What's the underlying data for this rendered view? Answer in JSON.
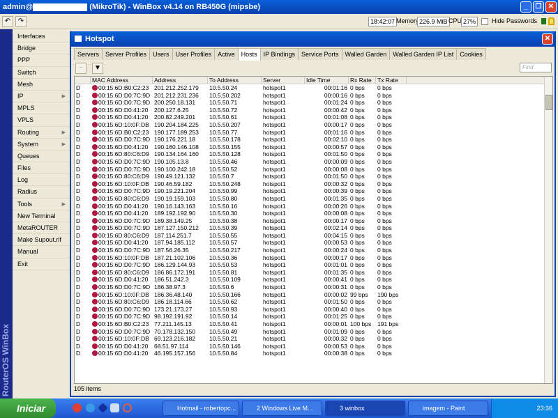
{
  "window": {
    "title_prefix": "admin@",
    "title_suffix": "(MikroTik) - WinBox v4.14 on RB450G (mipsbe)"
  },
  "toolbar": {
    "undo": "↶",
    "redo": "↷",
    "time": "18:42:07",
    "memory_label": "Memory:",
    "memory": "226.9 MiB",
    "cpu_label": "CPU:",
    "cpu": "27%",
    "hide_passwords": "Hide Passwords"
  },
  "sidebar": {
    "brand": "RouterOS WinBox",
    "items": [
      {
        "label": "Interfaces"
      },
      {
        "label": "Bridge"
      },
      {
        "label": "PPP"
      },
      {
        "label": "Switch"
      },
      {
        "label": "Mesh"
      },
      {
        "label": "IP",
        "sub": "▶"
      },
      {
        "label": "MPLS"
      },
      {
        "label": "VPLS"
      },
      {
        "label": "Routing",
        "sub": "▶"
      },
      {
        "label": "System",
        "sub": "▶"
      },
      {
        "label": "Queues"
      },
      {
        "label": "Files"
      },
      {
        "label": "Log"
      },
      {
        "label": "Radius"
      },
      {
        "label": "Tools",
        "sub": "▶"
      },
      {
        "label": "New Terminal"
      },
      {
        "label": "MetaROUTER"
      },
      {
        "label": "Make Supout.rif"
      },
      {
        "label": "Manual"
      },
      {
        "label": "Exit"
      }
    ]
  },
  "hotspot": {
    "title": "Hotspot",
    "tabs": [
      "Servers",
      "Server Profiles",
      "Users",
      "User Profiles",
      "Active",
      "Hosts",
      "IP Bindings",
      "Service Ports",
      "Walled Garden",
      "Walled Garden IP List",
      "Cookies"
    ],
    "active_tab": "Hosts",
    "find_placeholder": "Find",
    "columns": [
      "",
      "MAC Address",
      "Address",
      "To Address",
      "Server",
      "Idle Time",
      "Rx Rate",
      "Tx Rate"
    ],
    "rows": [
      [
        "D",
        "00:15:6D:B0:C2:23",
        "201.212.252.179",
        "10.5.50.24",
        "hotspot1",
        "00:01:16",
        "0 bps",
        "0 bps"
      ],
      [
        "D",
        "00:15:6D:D0:7C:9D",
        "201.212.231.236",
        "10.5.50.202",
        "hotspot1",
        "00:00:16",
        "0 bps",
        "0 bps"
      ],
      [
        "D",
        "00:15:6D:D0:7C:9D",
        "200.250.18.131",
        "10.5.50.71",
        "hotspot1",
        "00:01:24",
        "0 bps",
        "0 bps"
      ],
      [
        "D",
        "00:15:6D:D0:41:20",
        "200.127.6.25",
        "10.5.50.72",
        "hotspot1",
        "00:00:42",
        "0 bps",
        "0 bps"
      ],
      [
        "D",
        "00:15:6D:D0:41:20",
        "200.82.249.201",
        "10.5.50.61",
        "hotspot1",
        "00:01:08",
        "0 bps",
        "0 bps"
      ],
      [
        "D",
        "00:15:6D:10:0F:DB",
        "190.204.184.225",
        "10.5.50.207",
        "hotspot1",
        "00:00:17",
        "0 bps",
        "0 bps"
      ],
      [
        "D",
        "00:15:6D:B0:C2:23",
        "190.177.189.253",
        "10.5.50.77",
        "hotspot1",
        "00:01:16",
        "0 bps",
        "0 bps"
      ],
      [
        "D",
        "00:15:6D:D0:7C:9D",
        "190.176.221.18",
        "10.5.50.178",
        "hotspot1",
        "00:02:10",
        "0 bps",
        "0 bps"
      ],
      [
        "D",
        "00:15:6D:D0:41:20",
        "190.160.146.108",
        "10.5.50.155",
        "hotspot1",
        "00:00:57",
        "0 bps",
        "0 bps"
      ],
      [
        "D",
        "00:15:6D:80:C6:D9",
        "190.134.164.160",
        "10.5.50.128",
        "hotspot1",
        "00:01:50",
        "0 bps",
        "0 bps"
      ],
      [
        "D",
        "00:15:6D:D0:7C:9D",
        "190.105.13.8",
        "10.5.50.46",
        "hotspot1",
        "00:00:09",
        "0 bps",
        "0 bps"
      ],
      [
        "D",
        "00:15:6D:D0:7C:9D",
        "190.100.242.18",
        "10.5.50.52",
        "hotspot1",
        "00:00:08",
        "0 bps",
        "0 bps"
      ],
      [
        "D",
        "00:15:6D:80:C6:D9",
        "190.49.121.132",
        "10.5.50.7",
        "hotspot1",
        "00:01:50",
        "0 bps",
        "0 bps"
      ],
      [
        "D",
        "00:15:6D:10:0F:DB",
        "190.46.59.182",
        "10.5.50.248",
        "hotspot1",
        "00:00:32",
        "0 bps",
        "0 bps"
      ],
      [
        "D",
        "00:15:6D:D0:7C:9D",
        "190.19.221.204",
        "10.5.50.99",
        "hotspot1",
        "00:00:39",
        "0 bps",
        "0 bps"
      ],
      [
        "D",
        "00:15:6D:80:C6:D9",
        "190.19.159.103",
        "10.5.50.80",
        "hotspot1",
        "00:01:35",
        "0 bps",
        "0 bps"
      ],
      [
        "D",
        "00:15:6D:D0:41:20",
        "190.16.143.163",
        "10.5.50.16",
        "hotspot1",
        "00:00:26",
        "0 bps",
        "0 bps"
      ],
      [
        "D",
        "00:15:6D:D0:41:20",
        "189.192.192.90",
        "10.5.50.30",
        "hotspot1",
        "00:00:08",
        "0 bps",
        "0 bps"
      ],
      [
        "D",
        "00:15:6D:D0:7C:9D",
        "189.38.149.25",
        "10.5.50.38",
        "hotspot1",
        "00:00:17",
        "0 bps",
        "0 bps"
      ],
      [
        "D",
        "00:15:6D:D0:7C:9D",
        "187.127.150.212",
        "10.5.50.39",
        "hotspot1",
        "00:02:14",
        "0 bps",
        "0 bps"
      ],
      [
        "D",
        "00:15:6D:80:C6:D9",
        "187.114.251.7",
        "10.5.50.55",
        "hotspot1",
        "00:04:15",
        "0 bps",
        "0 bps"
      ],
      [
        "D",
        "00:15:6D:D0:41:20",
        "187.94.185.112",
        "10.5.50.57",
        "hotspot1",
        "00:00:53",
        "0 bps",
        "0 bps"
      ],
      [
        "D",
        "00:15:6D:D0:7C:9D",
        "187.56.26.35",
        "10.5.50.217",
        "hotspot1",
        "00:00:24",
        "0 bps",
        "0 bps"
      ],
      [
        "D",
        "00:15:6D:10:0F:DB",
        "187.21.102.106",
        "10.5.50.36",
        "hotspot1",
        "00:00:17",
        "0 bps",
        "0 bps"
      ],
      [
        "D",
        "00:15:6D:D0:7C:9D",
        "186.129.144.93",
        "10.5.50.53",
        "hotspot1",
        "00:01:01",
        "0 bps",
        "0 bps"
      ],
      [
        "D",
        "00:15:6D:80:C6:D9",
        "186.86.172.191",
        "10.5.50.81",
        "hotspot1",
        "00:01:35",
        "0 bps",
        "0 bps"
      ],
      [
        "D",
        "00:15:6D:D0:41:20",
        "186.51.242.3",
        "10.5.50.109",
        "hotspot1",
        "00:00:41",
        "0 bps",
        "0 bps"
      ],
      [
        "D",
        "00:15:6D:D0:7C:9D",
        "186.38.97.3",
        "10.5.50.6",
        "hotspot1",
        "00:00:31",
        "0 bps",
        "0 bps"
      ],
      [
        "D",
        "00:15:6D:10:0F:DB",
        "186.36.48.140",
        "10.5.50.166",
        "hotspot1",
        "00:00:02",
        "99 bps",
        "190 bps"
      ],
      [
        "D",
        "00:15:6D:80:C6:D9",
        "186.18.114.66",
        "10.5.50.62",
        "hotspot1",
        "00:01:50",
        "0 bps",
        "0 bps"
      ],
      [
        "D",
        "00:15:6D:D0:7C:9D",
        "173.21.173.27",
        "10.5.50.93",
        "hotspot1",
        "00:00:40",
        "0 bps",
        "0 bps"
      ],
      [
        "D",
        "00:15:6D:D0:7C:9D",
        "98.192.191.92",
        "10.5.50.14",
        "hotspot1",
        "00:01:25",
        "0 bps",
        "0 bps"
      ],
      [
        "D",
        "00:15:6D:B0:C2:23",
        "77.211.145.13",
        "10.5.50.41",
        "hotspot1",
        "00:00:01",
        "100 bps",
        "191 bps"
      ],
      [
        "D",
        "00:15:6D:D0:7C:9D",
        "70.178.132.150",
        "10.5.50.49",
        "hotspot1",
        "00:01:09",
        "0 bps",
        "0 bps"
      ],
      [
        "D",
        "00:15:6D:10:0F:DB",
        "69.123.216.182",
        "10.5.50.21",
        "hotspot1",
        "00:00:32",
        "0 bps",
        "0 bps"
      ],
      [
        "D",
        "00:15:6D:D0:41:20",
        "68.51.97.114",
        "10.5.50.146",
        "hotspot1",
        "00:00:53",
        "0 bps",
        "0 bps"
      ],
      [
        "D",
        "00:15:6D:D0:41:20",
        "46.195.157.156",
        "10.5.50.84",
        "hotspot1",
        "00:00:38",
        "0 bps",
        "0 bps"
      ]
    ],
    "status": "105 items"
  },
  "taskbar": {
    "start": "Iniciar",
    "tasks": [
      "Hotmail - robertopc...",
      "2 Windows Live M...",
      "3 winbox",
      "imagem - Paint"
    ],
    "clock": "23:36"
  }
}
